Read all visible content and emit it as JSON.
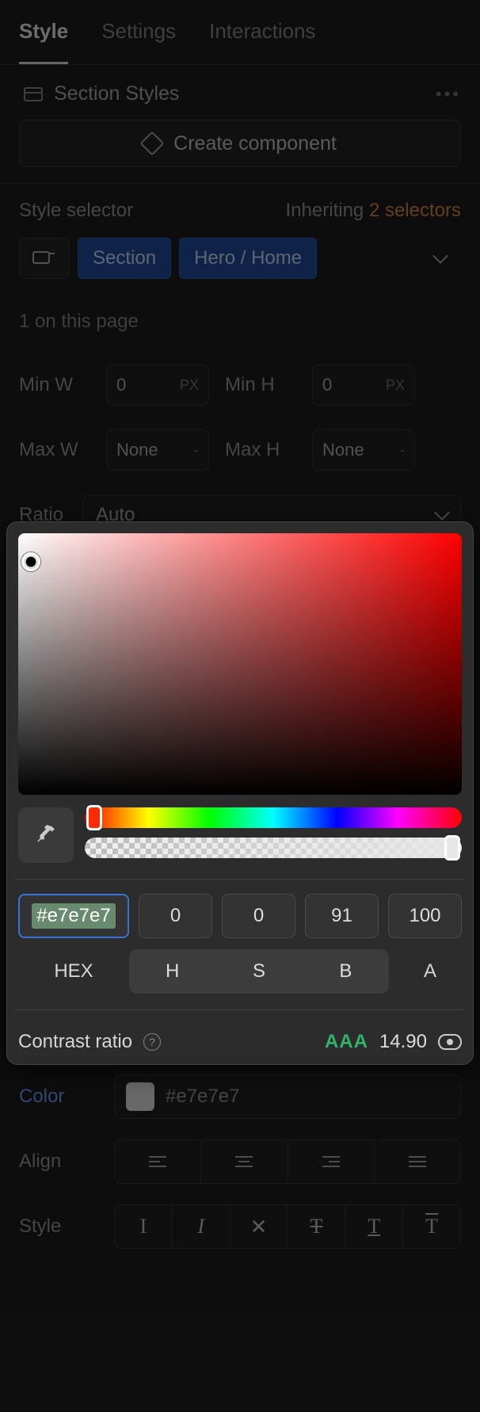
{
  "tabs": {
    "style": "Style",
    "settings": "Settings",
    "interactions": "Interactions"
  },
  "section": {
    "title": "Section Styles",
    "createComponent": "Create component"
  },
  "styleSelector": {
    "label": "Style selector",
    "inheritingPrefix": "Inheriting ",
    "inheritingCount": "2 selectors",
    "chips": {
      "section": "Section",
      "heroHome": "Hero / Home"
    },
    "onPage": "1 on this page"
  },
  "size": {
    "minW": {
      "label": "Min W",
      "value": "0",
      "unit": "PX"
    },
    "minH": {
      "label": "Min H",
      "value": "0",
      "unit": "PX"
    },
    "maxW": {
      "label": "Max W",
      "value": "None",
      "unit": "-"
    },
    "maxH": {
      "label": "Max H",
      "value": "None",
      "unit": "-"
    }
  },
  "ratio": {
    "label": "Ratio",
    "value": "Auto"
  },
  "colorPicker": {
    "hex": "#e7e7e7",
    "h": "0",
    "s": "0",
    "b": "91",
    "a": "100",
    "modeLabels": {
      "hex": "HEX",
      "h": "H",
      "s": "S",
      "b": "B",
      "a": "A"
    },
    "contrast": {
      "label": "Contrast ratio",
      "rating": "AAA",
      "score": "14.90"
    }
  },
  "typography": {
    "color": {
      "label": "Color",
      "value": "#e7e7e7",
      "swatch": "#e7e7e7"
    },
    "align": {
      "label": "Align"
    },
    "style": {
      "label": "Style"
    }
  }
}
